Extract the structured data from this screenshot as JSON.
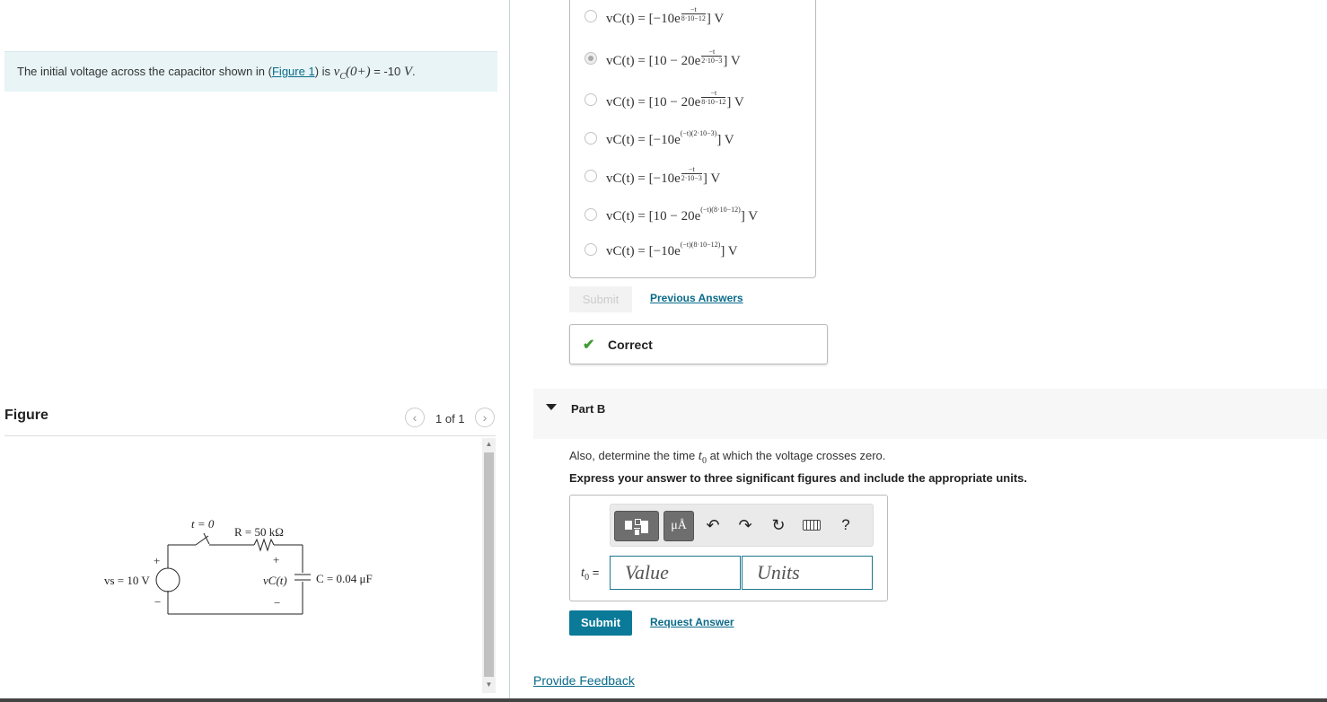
{
  "prompt": {
    "prefix": "The initial voltage across the capacitor shown in (",
    "link": "Figure 1",
    "suffix": ") is ",
    "math": "vC(0+)",
    "equals": " = -10 ",
    "unit": "V",
    "end": "."
  },
  "figure": {
    "title": "Figure",
    "count": "1 of 1",
    "prev_icon": "chevron-left",
    "next_icon": "chevron-right",
    "circuit": {
      "switch_label": "t = 0",
      "resistor_label": "R = 50 kΩ",
      "source_label": "vs = 10 V",
      "cap_voltage_label": "vC(t)",
      "cap_label": "C = 0.04 μF",
      "plus": "+",
      "minus": "−"
    }
  },
  "options": [
    {
      "lhs": "vC(t) = [−10e",
      "num": "−t",
      "den": "8·10−12",
      "rhs": "] V",
      "selected": false
    },
    {
      "lhs": "vC(t) = [10 − 20e",
      "num": "−t",
      "den": "2·10−3",
      "rhs": "] V",
      "selected": true
    },
    {
      "lhs": "vC(t) = [10 − 20e",
      "num": "−t",
      "den": "8·10−12",
      "rhs": "] V",
      "selected": false
    },
    {
      "lhs": "vC(t) = [−10e",
      "sup": "(−t)(2·10−3)",
      "rhs": "] V",
      "selected": false
    },
    {
      "lhs": "vC(t) = [−10e",
      "num": "−t",
      "den": "2·10−3",
      "rhs": "] V",
      "selected": false
    },
    {
      "lhs": "vC(t) = [10 − 20e",
      "sup": "(−t)(8·10−12)",
      "rhs": "] V",
      "selected": false
    },
    {
      "lhs": "vC(t) = [−10e",
      "sup": "(−t)(8·10−12)",
      "rhs": "] V",
      "selected": false
    }
  ],
  "part_a": {
    "submit_label": "Submit",
    "previous_answers": "Previous Answers",
    "feedback": "Correct"
  },
  "part_b": {
    "title": "Part B",
    "question_prefix": "Also, determine the time ",
    "question_math": "t0",
    "question_suffix": " at which the voltage crosses zero.",
    "instruction": "Express your answer to three significant figures and include the appropriate units.",
    "toolbar": {
      "template_icon": "templates-icon",
      "units_label": "μÅ",
      "undo_icon": "undo",
      "redo_icon": "redo",
      "reset_icon": "reset",
      "keyboard_icon": "keyboard",
      "help_label": "?"
    },
    "answer_label": "t0 =",
    "value_placeholder": "Value",
    "units_placeholder": "Units",
    "submit_label": "Submit",
    "request_answer": "Request Answer"
  },
  "footer": {
    "provide_feedback": "Provide Feedback"
  },
  "colors": {
    "accent": "#0b7a99",
    "link": "#0a6b8a",
    "correct": "#3f9c35",
    "prompt_bg": "#e8f4f6"
  }
}
